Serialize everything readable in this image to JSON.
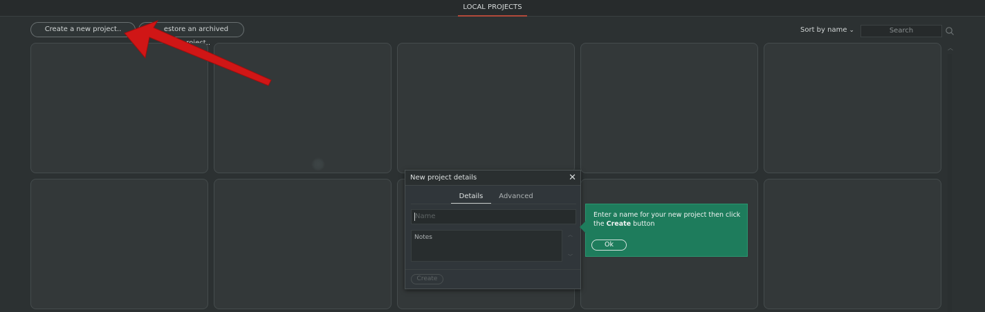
{
  "header": {
    "tab_label": "LOCAL PROJECTS"
  },
  "toolbar": {
    "create_label": "Create a new project..",
    "archive_label": "estore an archived project..",
    "sort_label": "Sort by name",
    "search_placeholder": "Search"
  },
  "dialog": {
    "title": "New project details",
    "close_glyph": "✕",
    "tabs": [
      {
        "label": "Details"
      },
      {
        "label": "Advanced"
      }
    ],
    "name_placeholder": "Name",
    "notes_placeholder": "Notes",
    "create_label": "Create"
  },
  "tooltip": {
    "text_before": "Enter a name for your new project then click the ",
    "text_bold": "Create",
    "text_after": " button",
    "ok_label": "Ok"
  },
  "colors": {
    "accent_tab_underline": "#b34a3a",
    "tooltip_bg": "#1e7c5c",
    "annotation_arrow": "#d01616"
  },
  "icons": [
    "search-icon",
    "chevron-down-icon",
    "close-icon",
    "scroll-up-icon",
    "scroll-down-icon"
  ]
}
